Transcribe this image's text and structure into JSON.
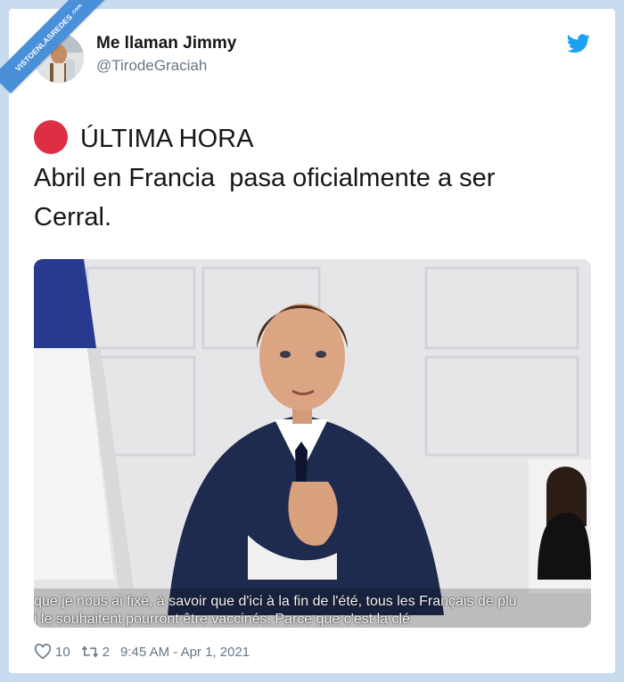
{
  "watermark": {
    "text": "VISTOENLASREDES",
    "sub": ".com"
  },
  "tweet": {
    "author_name": "Me llaman Jimmy",
    "author_handle": "@TirodeGraciah",
    "text_lines": [
      "ÚLTIMA HORA",
      "Abril en Francia  pasa oficialmente a ser",
      "Cerral."
    ],
    "media": {
      "subtitle_line1": "que je nous ai fixé, à savoir que d'ici à la fin de l'été, tous les Français de plu",
      "subtitle_line2": "i le souhaitent pourront être vaccinés. Parce que c'est la clé"
    },
    "likes": "10",
    "retweets": "2",
    "timestamp": "9:45 AM - Apr 1, 2021"
  },
  "colors": {
    "background": "#c9dcef",
    "twitter_blue": "#1da1f2",
    "red_circle": "#dd2e44",
    "secondary_text": "#657786"
  },
  "icons": {
    "brand": "twitter-bird-icon",
    "status": "red-circle-icon",
    "like": "heart-icon",
    "retweet": "retweet-icon"
  }
}
